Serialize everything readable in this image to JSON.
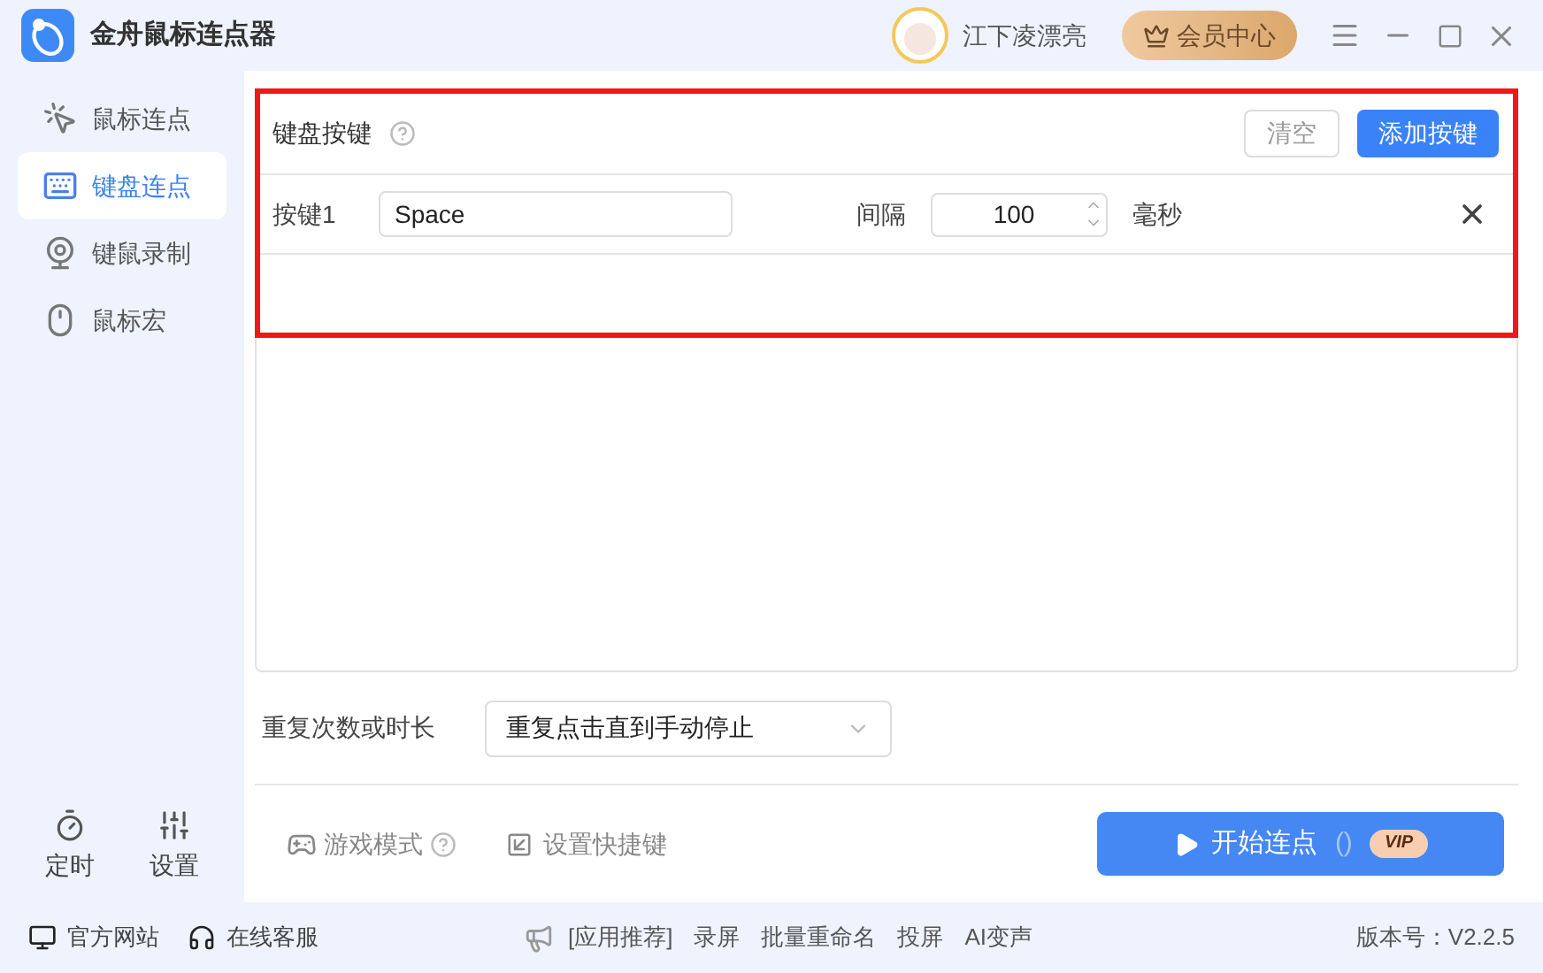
{
  "window": {
    "title": "金舟鼠标连点器"
  },
  "user": {
    "name": "江下凌漂亮"
  },
  "vip_button": {
    "label": "会员中心"
  },
  "sidebar": {
    "items": [
      {
        "label": "鼠标连点",
        "kind": "cursor",
        "selected": false
      },
      {
        "label": "键盘连点",
        "kind": "keyboard",
        "selected": true
      },
      {
        "label": "键鼠录制",
        "kind": "camera",
        "selected": false
      },
      {
        "label": "鼠标宏",
        "kind": "mouse",
        "selected": false
      }
    ],
    "bottom": [
      {
        "label": "定时",
        "kind": "timer"
      },
      {
        "label": "设置",
        "kind": "sliders"
      }
    ]
  },
  "keys_panel": {
    "title": "键盘按键",
    "clear_button": "清空",
    "add_button": "添加按键",
    "rows": [
      {
        "label": "按键1",
        "key": "Space",
        "interval_label": "间隔",
        "interval": "100",
        "unit": "毫秒"
      }
    ]
  },
  "repeat": {
    "label": "重复次数或时长",
    "value": "重复点击直到手动停止"
  },
  "game_mode": {
    "label": "游戏模式"
  },
  "hotkey": {
    "label": "设置快捷键"
  },
  "start_button": {
    "label": "开始连点",
    "shortcut": "()",
    "badge": "VIP"
  },
  "footer": {
    "links": [
      {
        "label": "官方网站",
        "kind": "monitor"
      },
      {
        "label": "在线客服",
        "kind": "headset"
      }
    ],
    "recommend_label": "[应用推荐]",
    "apps": [
      "录屏",
      "批量重命名",
      "投屏",
      "AI变声"
    ],
    "version": "版本号：V2.2.5"
  }
}
